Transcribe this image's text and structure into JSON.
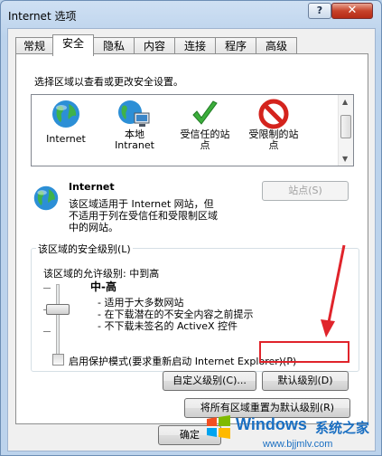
{
  "window": {
    "title": "Internet 选项",
    "help_label": "?",
    "close_label": "✕"
  },
  "tabs": [
    {
      "label": "常规"
    },
    {
      "label": "安全"
    },
    {
      "label": "隐私"
    },
    {
      "label": "内容"
    },
    {
      "label": "连接"
    },
    {
      "label": "程序"
    },
    {
      "label": "高级"
    }
  ],
  "active_tab": "安全",
  "security": {
    "select_zone_text": "选择区域以查看或更改安全设置。",
    "zones": [
      {
        "label": "Internet",
        "icon": "globe-icon"
      },
      {
        "label": "本地\nIntranet",
        "icon": "intranet-icon"
      },
      {
        "label": "受信任的站\n点",
        "icon": "check-icon"
      },
      {
        "label": "受限制的站\n点",
        "icon": "restricted-icon"
      }
    ],
    "selected_zone": "Internet",
    "zone_desc_line1": "该区域适用于 Internet 网站，但",
    "zone_desc_line2": "不适用于列在受信任和受限制区域",
    "zone_desc_line3": "中的网站。",
    "sites_button": "站点(S)",
    "level_group_title": "该区域的安全级别(L)",
    "allowed_levels": "该区域的允许级别: 中到高",
    "level_name": "中-高",
    "level_bullets": [
      "- 适用于大多数网站",
      "- 在下载潜在的不安全内容之前提示",
      "- 不下载未签名的 ActiveX 控件"
    ],
    "protected_mode_label": "启用保护模式(要求重新启动 Internet Explorer)(P)",
    "protected_mode_checked": false,
    "custom_level_button": "自定义级别(C)...",
    "default_level_button": "默认级别(D)",
    "reset_all_button": "将所有区域重置为默认级别(R)"
  },
  "footer": {
    "ok_button": "确定"
  },
  "watermark": {
    "brand": "Windows",
    "suffix": "系统之家",
    "url": "www.bjjmlv.com"
  },
  "colors": {
    "accent_red": "#e0242b",
    "watermark_blue": "#1a6fc2"
  }
}
